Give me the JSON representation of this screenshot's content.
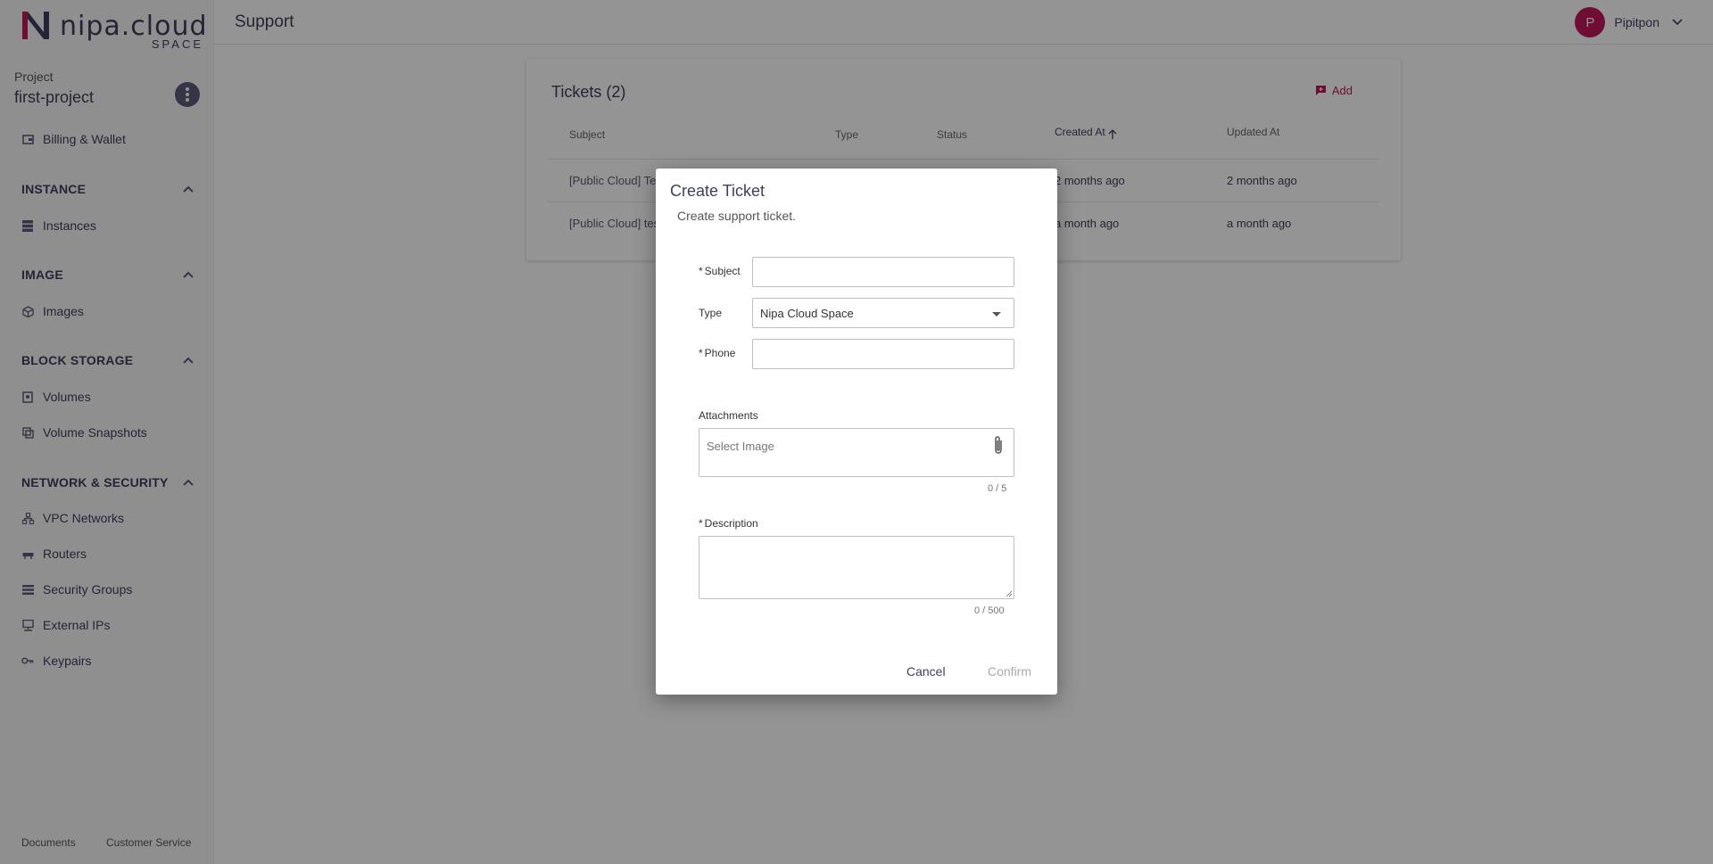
{
  "brand": {
    "name": "nipa.cloud",
    "sub": "SPACE",
    "accent": "#c0185c",
    "dark": "#3d3f5c"
  },
  "sidebar": {
    "project_label": "Project",
    "project_name": "first-project",
    "billing": "Billing & Wallet",
    "sections": {
      "instance": {
        "title": "INSTANCE",
        "items": [
          "Instances"
        ]
      },
      "image": {
        "title": "IMAGE",
        "items": [
          "Images"
        ]
      },
      "block_storage": {
        "title": "BLOCK STORAGE",
        "items": [
          "Volumes",
          "Volume Snapshots"
        ]
      },
      "network": {
        "title": "NETWORK & SECURITY",
        "items": [
          "VPC Networks",
          "Routers",
          "Security Groups",
          "External IPs",
          "Keypairs"
        ]
      }
    },
    "footer": {
      "documents": "Documents",
      "customer_service": "Customer Service"
    }
  },
  "header": {
    "title": "Support",
    "user_initial": "P",
    "user_name": "Pipitpon"
  },
  "tickets": {
    "title": "Tickets (2)",
    "add_label": "Add",
    "columns": [
      "Subject",
      "Type",
      "Status",
      "Created At",
      "Updated At"
    ],
    "rows": [
      {
        "subject": "[Public Cloud] Te",
        "created": "2 months ago",
        "updated": "2 months ago"
      },
      {
        "subject": "[Public Cloud] tes",
        "created": "a month ago",
        "updated": "a month ago"
      }
    ]
  },
  "modal": {
    "title": "Create Ticket",
    "subtitle": "Create support ticket.",
    "subject_label": "Subject",
    "type_label": "Type",
    "type_value": "Nipa Cloud Space",
    "phone_label": "Phone",
    "attachments_label": "Attachments",
    "attachments_placeholder": "Select Image",
    "attachments_counter": "0 / 5",
    "description_label": "Description",
    "description_counter": "0 / 500",
    "cancel": "Cancel",
    "confirm": "Confirm"
  }
}
